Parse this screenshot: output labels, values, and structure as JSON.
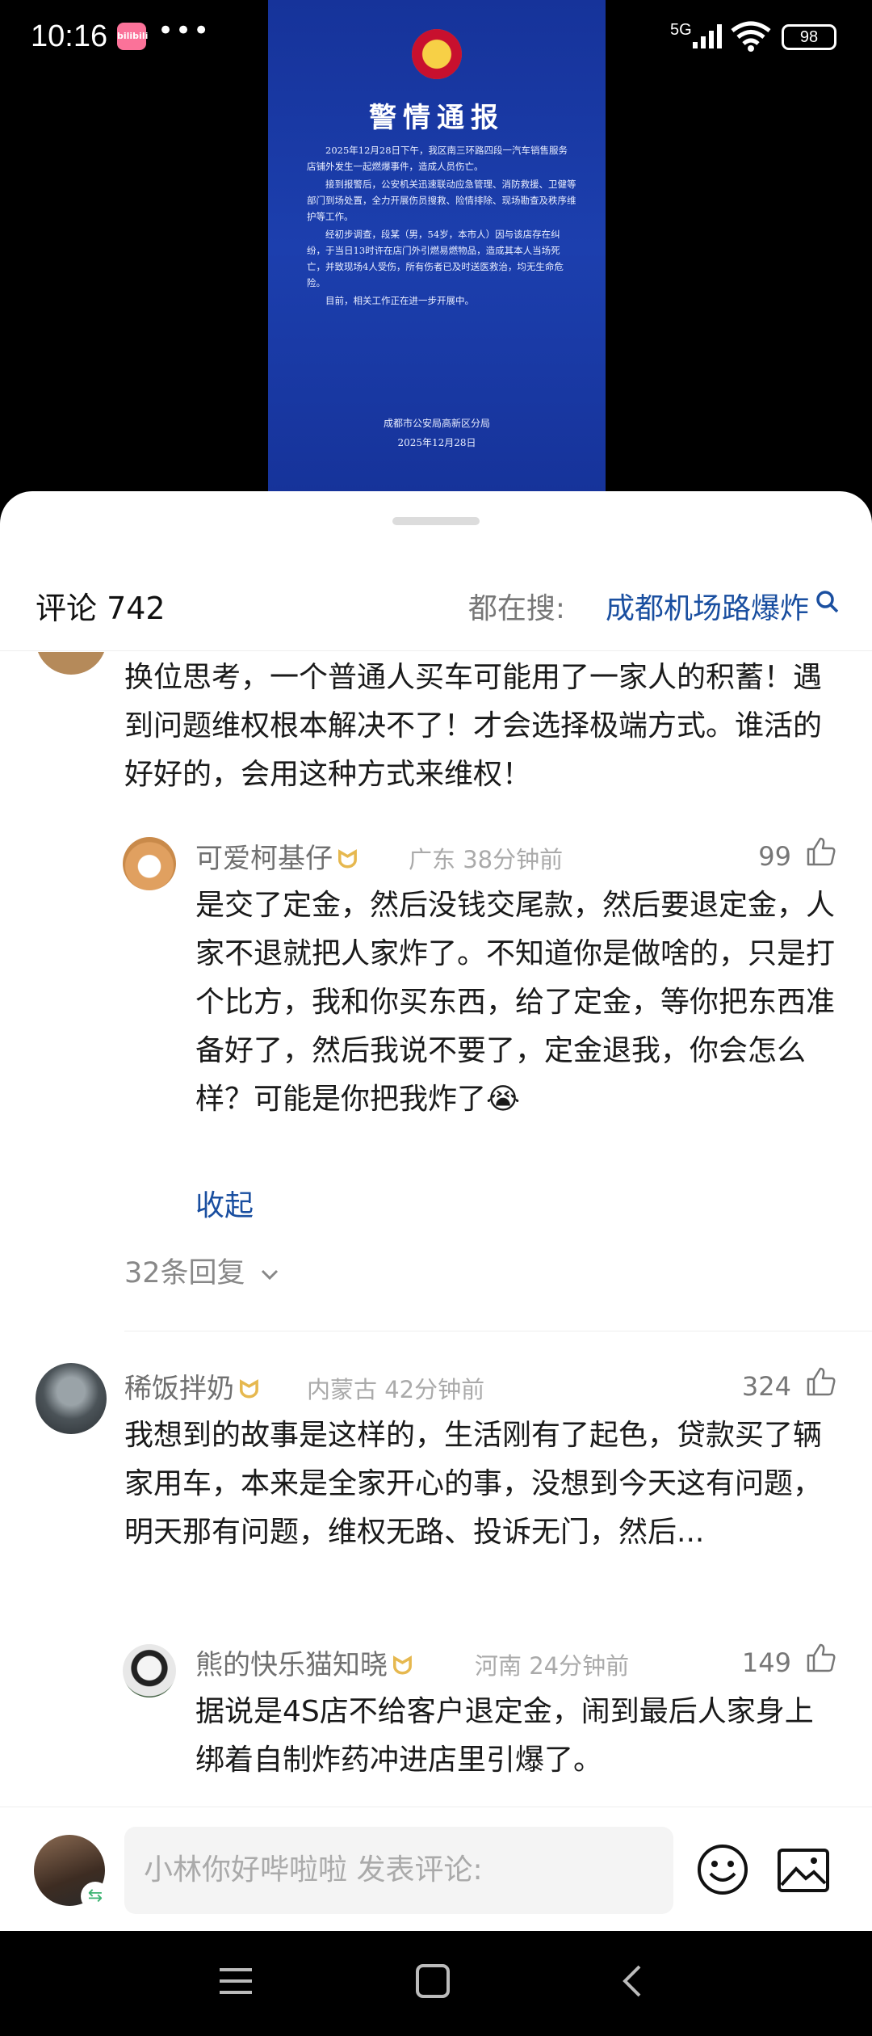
{
  "status_bar": {
    "time": "10:16",
    "app_badge": "bilibili",
    "dots": "•••",
    "network": "5G",
    "battery": "98"
  },
  "notice": {
    "title": "警情通报",
    "paragraphs": [
      "2025年12月28日下午，我区南三环路四段一汽车销售服务店铺外发生一起燃爆事件，造成人员伤亡。",
      "接到报警后，公安机关迅速联动应急管理、消防救援、卫健等部门到场处置，全力开展伤员搜救、险情排除、现场勘查及秩序维护等工作。",
      "经初步调查，段某（男，54岁，本市人）因与该店存在纠纷，于当日13时许在店门外引燃易燃物品，造成其本人当场死亡，并致现场4人受伤，所有伤者已及时送医救治，均无生命危险。",
      "目前，相关工作正在进一步开展中。"
    ],
    "signature": "成都市公安局高新区分局",
    "date": "2025年12月28日"
  },
  "header": {
    "comment_count": "评论 742",
    "search_label": "都在搜:",
    "search_term": "成都机场路爆炸"
  },
  "comments": {
    "c1": {
      "text": "换位思考，一个普通人买车可能用了一家人的积蓄！遇到问题维权根本解决不了！才会选择极端方式。谁活的好好的，会用这种方式来维权！"
    },
    "r1": {
      "user": "可爱柯基仔",
      "meta": "广东 38分钟前",
      "likes": "99",
      "text": "是交了定金，然后没钱交尾款，然后要退定金，人家不退就把人家炸了。不知道你是做啥的，只是打个比方，我和你买东西，给了定金，等你把东西准备好了，然后我说不要了，定金退我，你会怎么样？可能是你把我炸了",
      "emoji": "😭",
      "collapse": "收起"
    },
    "c1_replies": "32条回复",
    "c2": {
      "user": "稀饭拌奶",
      "meta": "内蒙古 42分钟前",
      "likes": "324",
      "text": "我想到的故事是这样的，生活刚有了起色，贷款买了辆家用车，本来是全家开心的事，没想到今天这有问题，明天那有问题，维权无路、投诉无门，然后..."
    },
    "r2": {
      "user": "熊的快乐猫知晓",
      "meta": "河南 24分钟前",
      "likes": "149",
      "text": "据说是4S店不给客户退定金，闹到最后人家身上绑着自制炸药冲进店里引爆了。"
    }
  },
  "input_bar": {
    "placeholder": "小林你好哔啦啦 发表评论:"
  },
  "crown_glyph": "ᗢ",
  "colors": {
    "accent_link": "#1a4fa0",
    "notice_bg": "#1c3fae"
  }
}
